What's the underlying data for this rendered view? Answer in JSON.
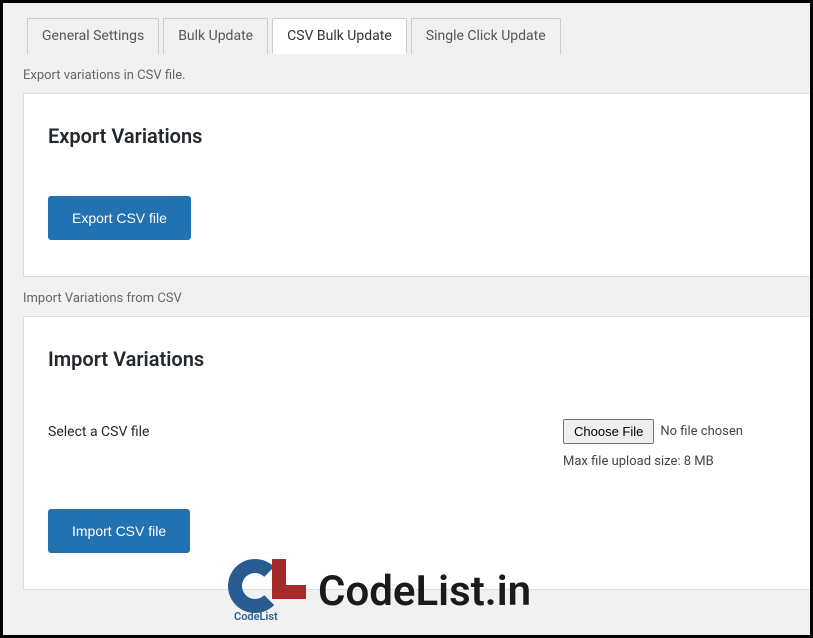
{
  "tabs": {
    "general": "General Settings",
    "bulk": "Bulk Update",
    "csv": "CSV Bulk Update",
    "single": "Single Click Update"
  },
  "export": {
    "desc": "Export variations in CSV file.",
    "heading": "Export Variations",
    "button": "Export CSV file"
  },
  "import": {
    "desc": "Import Variations from CSV",
    "heading": "Import Variations",
    "label": "Select a CSV file",
    "choose_button": "Choose File",
    "no_file": "No file chosen",
    "helper": "Max file upload size: 8 MB",
    "button": "Import CSV file"
  },
  "watermark": {
    "sub": "CodeList",
    "text": "CodeList.in"
  }
}
